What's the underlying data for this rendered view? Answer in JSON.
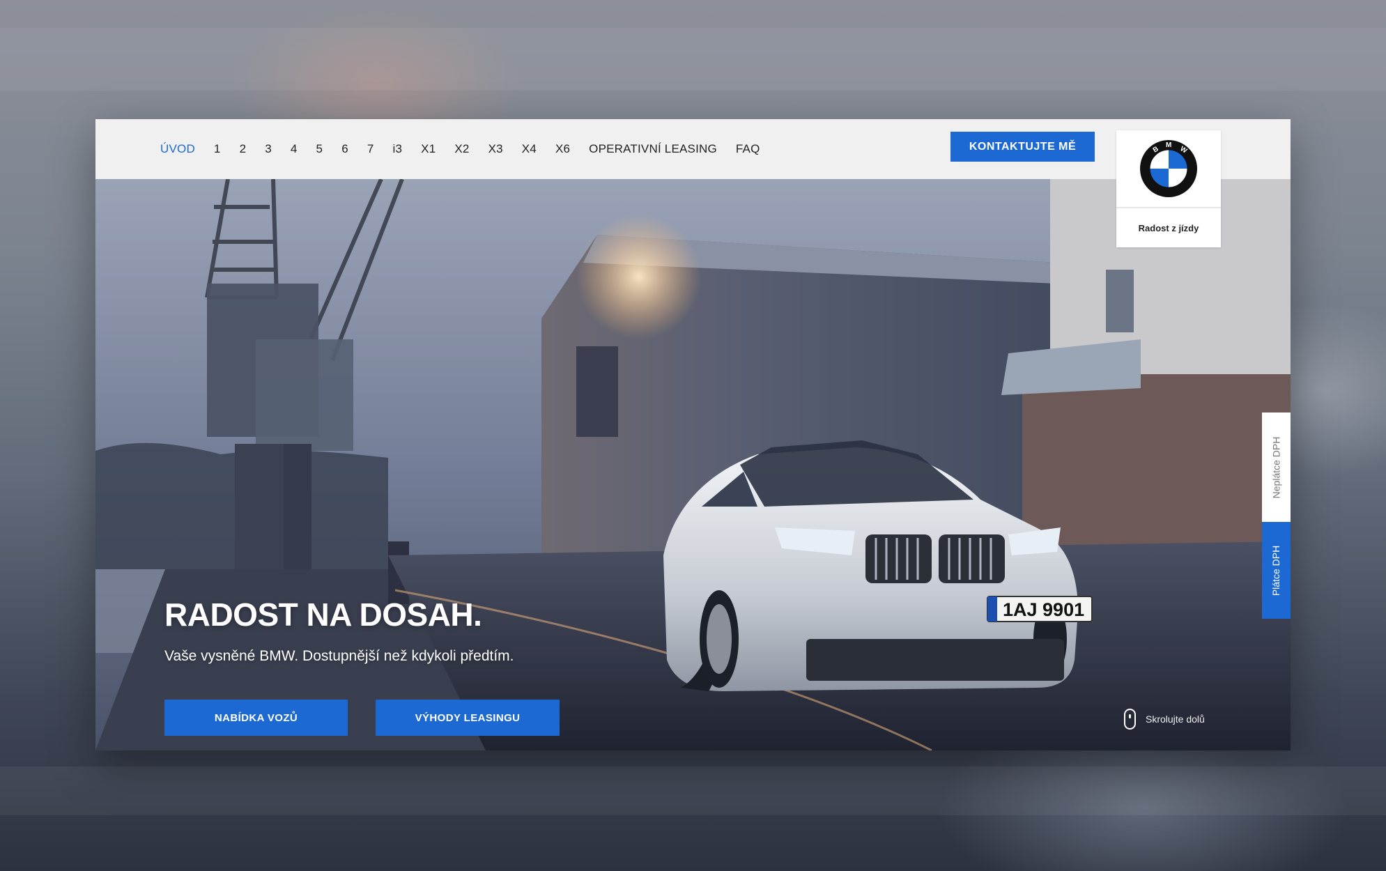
{
  "nav": {
    "items": [
      {
        "label": "ÚVOD",
        "active": true
      },
      {
        "label": "1"
      },
      {
        "label": "2"
      },
      {
        "label": "3"
      },
      {
        "label": "4"
      },
      {
        "label": "5"
      },
      {
        "label": "6"
      },
      {
        "label": "7"
      },
      {
        "label": "i3"
      },
      {
        "label": "X1"
      },
      {
        "label": "X2"
      },
      {
        "label": "X3"
      },
      {
        "label": "X4"
      },
      {
        "label": "X6"
      },
      {
        "label": "OPERATIVNÍ LEASING"
      },
      {
        "label": "FAQ"
      }
    ],
    "contact_label": "KONTAKTUJTE MĚ"
  },
  "logo": {
    "brand": "BMW",
    "tagline": "Radost z jízdy",
    "icon": "bmw-roundel-icon"
  },
  "hero": {
    "title": "RADOST NA DOSAH.",
    "subtitle": "Vaše vysněné BMW. Dostupnější než kdykoli předtím.",
    "offer_label": "NABÍDKA VOZŮ",
    "benefits_label": "VÝHODY LEASINGU",
    "scroll_label": "Skrolujte dolů",
    "plate": "1AJ 9901"
  },
  "vat": {
    "non_payer_label": "Neplátce DPH",
    "payer_label": "Plátce DPH",
    "selected": "Plátce DPH"
  },
  "colors": {
    "accent": "#1c69d3",
    "nav_bg": "#f0f0f0",
    "active_nav": "#1c69d3"
  }
}
